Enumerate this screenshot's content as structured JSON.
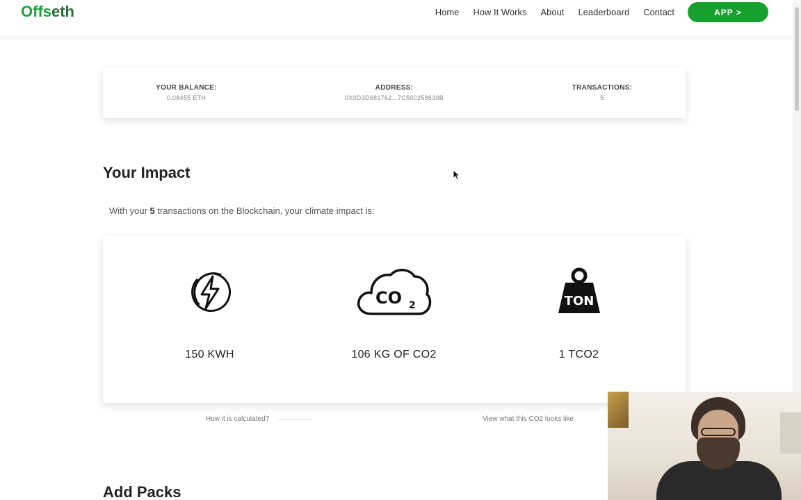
{
  "nav": {
    "logo_part1": "Offs",
    "logo_part2": "eth",
    "links": [
      "Home",
      "How It Works",
      "About",
      "Leaderboard",
      "Contact"
    ],
    "app_button": "APP >",
    "brand_color": "#16a12f"
  },
  "stats": {
    "balance_label": "YOUR BALANCE:",
    "balance_value": "0.08455 ETH",
    "address_label": "ADDRESS:",
    "address_value": "0X0D3D681762...7C500258630B",
    "transactions_label": "TRANSACTIONS:",
    "transactions_value": "5"
  },
  "impact": {
    "title": "Your Impact",
    "text_before": "With your ",
    "count": "5",
    "text_after": " transactions on the Blockchain, your climate impact is:",
    "metrics": [
      {
        "icon": "lightning-icon",
        "value": "150 KWH"
      },
      {
        "icon": "co2-cloud-icon",
        "value": "106 KG OF CO2"
      },
      {
        "icon": "ton-weight-icon",
        "value": "1 TCO2",
        "icon_text": "TON"
      }
    ],
    "co2_icon_text": "CO",
    "co2_icon_sub": "2",
    "how_calculated_link": "How it is calculated?",
    "view_co2_link": "View what this CO2 looks like"
  },
  "packs": {
    "title": "Add Packs"
  }
}
